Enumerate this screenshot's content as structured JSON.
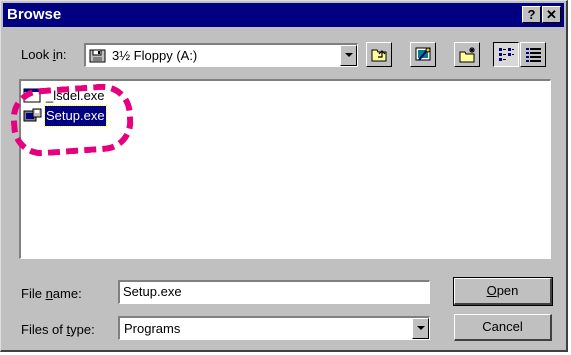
{
  "window": {
    "title": "Browse",
    "help_label": "?",
    "close_label": "✕"
  },
  "lookin": {
    "label_prefix": "Look ",
    "label_underlined": "i",
    "label_suffix": "n:",
    "value": "3½ Floppy (A:)"
  },
  "toolbar": {
    "buttons": [
      {
        "name": "up-one-level",
        "icon": "up-folder-icon"
      },
      {
        "name": "desktop",
        "icon": "desktop-icon"
      },
      {
        "name": "new-folder",
        "icon": "new-folder-icon"
      },
      {
        "name": "list-view",
        "icon": "list-view-icon",
        "pressed": true
      },
      {
        "name": "details-view",
        "icon": "details-view-icon"
      }
    ]
  },
  "files": [
    {
      "name": "_lsdel.exe",
      "icon": "exe-file-icon",
      "selected": false
    },
    {
      "name": "Setup.exe",
      "icon": "setup-program-icon",
      "selected": true
    }
  ],
  "filename": {
    "label_prefix": "File ",
    "label_underlined": "n",
    "label_suffix": "ame:",
    "value": "Setup.exe"
  },
  "filetype": {
    "label_prefix": "Files of ",
    "label_underlined": "t",
    "label_suffix": "ype:",
    "value": "Programs"
  },
  "buttons": {
    "open_underlined": "O",
    "open_rest": "pen",
    "cancel": "Cancel"
  },
  "colors": {
    "titlebar": "#000080",
    "face": "#c0c0c0",
    "annotation": "#e6007e"
  }
}
